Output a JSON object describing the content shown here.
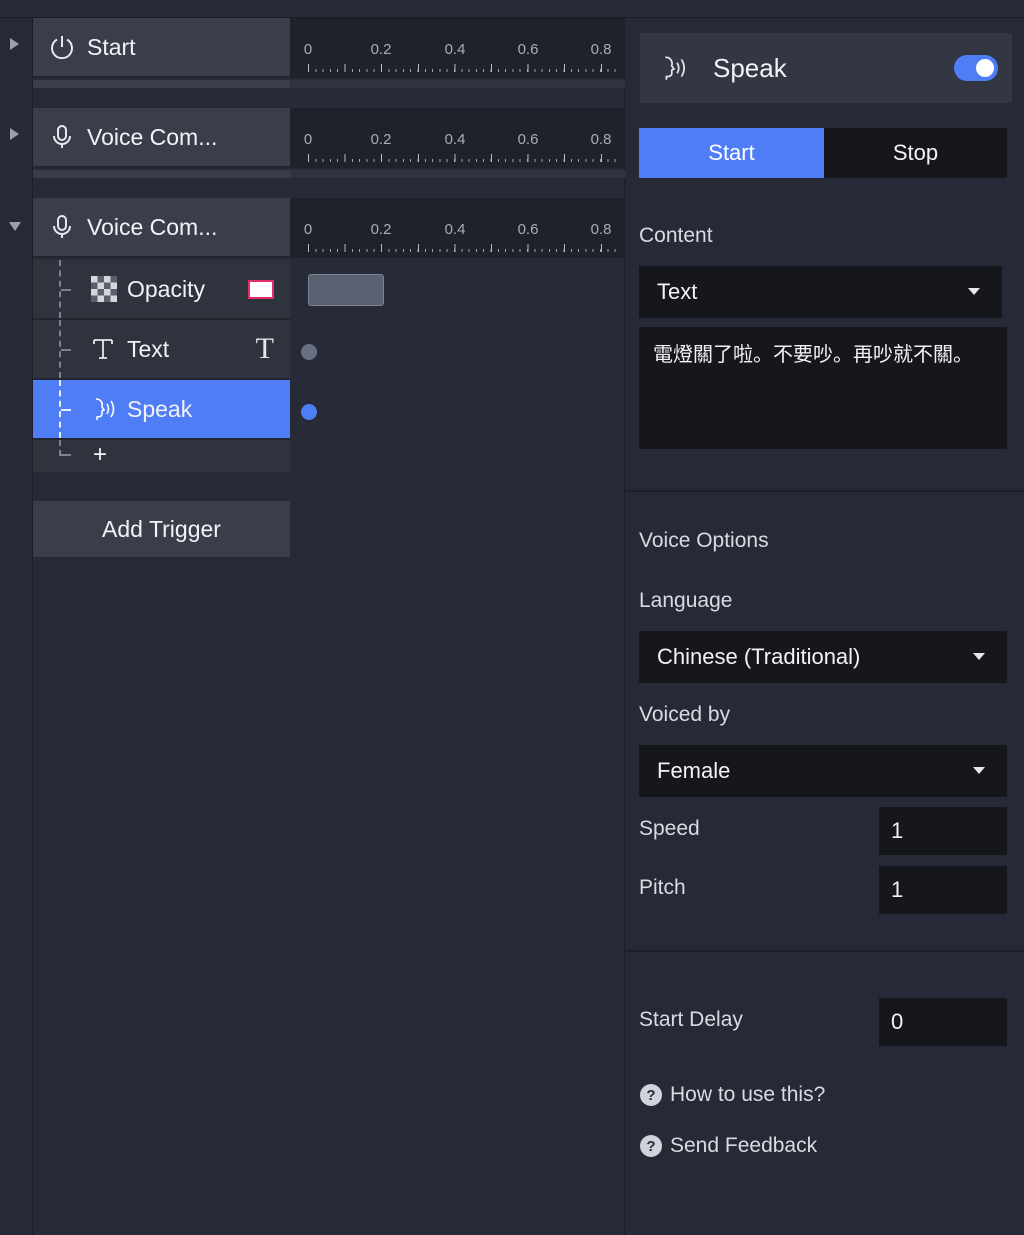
{
  "timeline": {
    "layers": [
      {
        "title": "Start",
        "icon": "power-icon",
        "expanded": false
      },
      {
        "title": "Voice Com...",
        "icon": "microphone-icon",
        "expanded": false
      },
      {
        "title": "Voice Com...",
        "icon": "microphone-icon",
        "expanded": true
      }
    ],
    "ruler_ticks": [
      "0",
      "0.2",
      "0.4",
      "0.6",
      "0.8"
    ],
    "actions": [
      {
        "title": "Opacity",
        "icon": "checkerboard-icon",
        "right_icon": "color-swatch-icon"
      },
      {
        "title": "Text",
        "icon": "text-icon",
        "right_icon": "text-glyph-icon",
        "right_glyph": "T"
      },
      {
        "title": "Speak",
        "icon": "speak-icon",
        "selected": true
      }
    ],
    "add_action_label": "+",
    "add_trigger_label": "Add Trigger"
  },
  "panel": {
    "title": "Speak",
    "enabled": true,
    "start_label": "Start",
    "stop_label": "Stop",
    "active_mode": "Start",
    "content_label": "Content",
    "content_type": "Text",
    "content_text": "電燈關了啦。不要吵。再吵就不關。",
    "voice_options_label": "Voice Options",
    "language_label": "Language",
    "language_value": "Chinese (Traditional)",
    "voiced_by_label": "Voiced by",
    "voiced_by_value": "Female",
    "speed_label": "Speed",
    "speed_value": "1",
    "pitch_label": "Pitch",
    "pitch_value": "1",
    "start_delay_label": "Start Delay",
    "start_delay_value": "0",
    "help_label": "How to use this?",
    "feedback_label": "Send Feedback"
  },
  "colors": {
    "accent": "#4f7df5",
    "background": "#262a36",
    "input": "#15171d"
  }
}
